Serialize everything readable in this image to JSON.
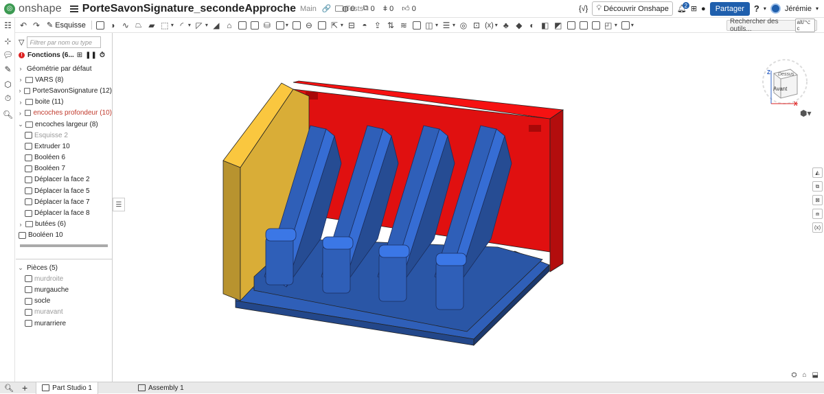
{
  "app": {
    "logo_text": "onshape",
    "document_title": "PorteSavonSignature_secondeApproche",
    "branch": "Main",
    "folder": "Tests",
    "stats": [
      {
        "icon": "globe-icon",
        "value": "0"
      },
      {
        "icon": "copy-icon",
        "value": "0"
      },
      {
        "icon": "branch-icon",
        "value": "0"
      },
      {
        "icon": "like-icon",
        "value": "0"
      }
    ]
  },
  "header_right": {
    "variable_label": "{√}",
    "discover_label": "Découvrir Onshape",
    "notifications_count": "2",
    "share_label": "Partager",
    "help_label": "?",
    "user_name": "Jérémie"
  },
  "toolbar": {
    "sketch_label": "Esquisse",
    "variable_label": "(x)",
    "search_placeholder": "Rechercher des outils...",
    "search_shortcut": "alt/⌥ c"
  },
  "panel": {
    "filter_placeholder": "Filtrer par nom ou type",
    "features_label": "Fonctions (6...",
    "tree": [
      {
        "type": "item",
        "expand": ">",
        "label": "Géométrie par défaut",
        "style": ""
      },
      {
        "type": "folder",
        "expand": ">",
        "label": "VARS (8)",
        "style": ""
      },
      {
        "type": "folder",
        "expand": ">",
        "label": "PorteSavonSignature (12)",
        "style": ""
      },
      {
        "type": "folder",
        "expand": ">",
        "label": "boite (11)",
        "style": ""
      },
      {
        "type": "folder",
        "expand": ">",
        "label": "encoches profondeur (10)",
        "style": "red"
      },
      {
        "type": "folder",
        "expand": "v",
        "label": "encoches largeur (8)",
        "style": ""
      },
      {
        "type": "feature",
        "expand": "",
        "label": "Esquisse 2",
        "style": "gray"
      },
      {
        "type": "feature",
        "expand": "",
        "label": "Extruder 10",
        "style": ""
      },
      {
        "type": "feature",
        "expand": "",
        "label": "Booléen 6",
        "style": ""
      },
      {
        "type": "feature",
        "expand": "",
        "label": "Booléen 7",
        "style": ""
      },
      {
        "type": "feature",
        "expand": "",
        "label": "Déplacer la face 2",
        "style": ""
      },
      {
        "type": "feature",
        "expand": "",
        "label": "Déplacer la face 5",
        "style": ""
      },
      {
        "type": "feature",
        "expand": "",
        "label": "Déplacer la face 7",
        "style": ""
      },
      {
        "type": "feature",
        "expand": "",
        "label": "Déplacer la face 8",
        "style": ""
      },
      {
        "type": "folder",
        "expand": ">",
        "label": "butées (6)",
        "style": ""
      },
      {
        "type": "root",
        "expand": "",
        "label": "Booléen 10",
        "style": ""
      }
    ],
    "parts_header": "Pièces (5)",
    "parts": [
      {
        "label": "murdroite",
        "style": "gray"
      },
      {
        "label": "murgauche",
        "style": ""
      },
      {
        "label": "socle",
        "style": ""
      },
      {
        "label": "muravant",
        "style": "gray"
      },
      {
        "label": "murarriere",
        "style": ""
      }
    ]
  },
  "viewcube": {
    "face_front": "Avant",
    "face_top": "Dessus",
    "axis_z": "Z",
    "axis_x": "X"
  },
  "colors": {
    "red_wall": "#e01010",
    "yellow_wall": "#d9ad37",
    "blue_body": "#2f5fb8",
    "brand_blue": "#1f5fad"
  },
  "tabs": [
    {
      "label": "Part Studio 1",
      "active": true
    },
    {
      "label": "Assembly 1",
      "active": false
    }
  ]
}
